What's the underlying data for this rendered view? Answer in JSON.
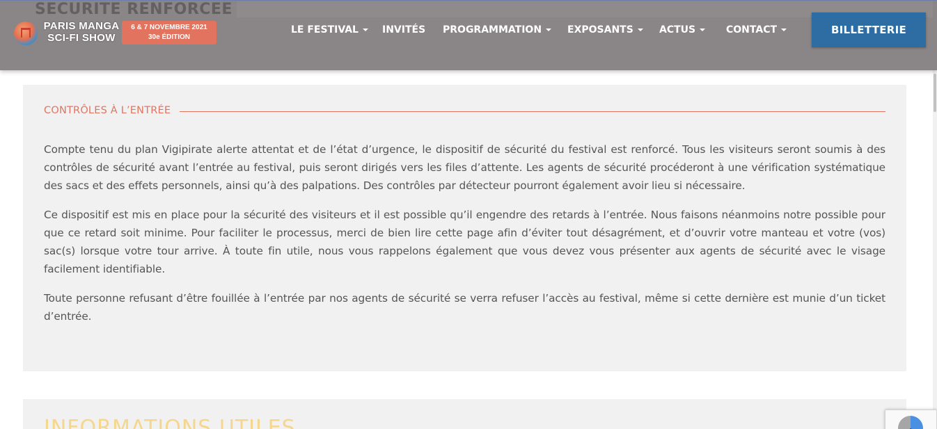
{
  "header": {
    "ghost_title": "SECURITE RENFORCEE",
    "logo": {
      "line1": "PARIS MANGA",
      "line2": "SCI-FI SHOW",
      "date": "6 & 7 NOVEMBRE 2021",
      "edition": "30e ÉDITION"
    },
    "nav": [
      {
        "label": "LE FESTIVAL",
        "dropdown": true
      },
      {
        "label": "INVITÉS",
        "dropdown": false
      },
      {
        "label": "PROGRAMMATION",
        "dropdown": true
      },
      {
        "label": "EXPOSANTS",
        "dropdown": true
      },
      {
        "label": "ACTUS",
        "dropdown": true
      },
      {
        "label": "CONTACT",
        "dropdown": true
      }
    ],
    "ticket_button": "BILLETTERIE"
  },
  "section": {
    "title": "CONTRÔLES À L’ENTRÉE",
    "paragraphs": [
      "Compte tenu du plan Vigipirate alerte attentat et de l’état d’urgence, le dispositif de sécurité du festival est renforcé. Tous les visiteurs seront soumis à des contrôles de sécurité avant l’entrée au festival, puis seront dirigés vers les files d’attente. Les agents de sécurité procéderont à une vérification systématique des sacs et des effets personnels, ainsi qu’à des palpations. Des contrôles par détecteur pourront également avoir lieu si nécessaire.",
      "Ce dispositif est mis en place pour la sécurité des visiteurs et il est possible qu’il engendre des retards à l’entrée. Nous faisons néanmoins notre possible pour que ce retard soit minime. Pour faciliter le processus, merci de bien lire cette page afin d’éviter tout désagrément, et d’ouvrir votre manteau et votre (vos) sac(s) lorsque votre tour arrive. À toute fin utile, nous vous rappelons également que vous devez vous présenter aux agents de sécurité avec le visage facilement identifiable.",
      "Toute personne refusant d’être fouillée à l’entrée par nos agents de sécurité se verra refuser l’accès au festival, même si cette dernière est munie d’un ticket d’entrée."
    ]
  },
  "next_section": {
    "title": "INFORMATIONS UTILES"
  },
  "colors": {
    "header_bg": "#8a8586",
    "accent": "#e2745f",
    "button_bg": "#2e6da4",
    "panel_bg": "#f1f1f1",
    "next_title": "#f7d27a"
  },
  "icons": {
    "logo_emblem": "torii-gate-icon",
    "recaptcha": "recaptcha-icon"
  }
}
